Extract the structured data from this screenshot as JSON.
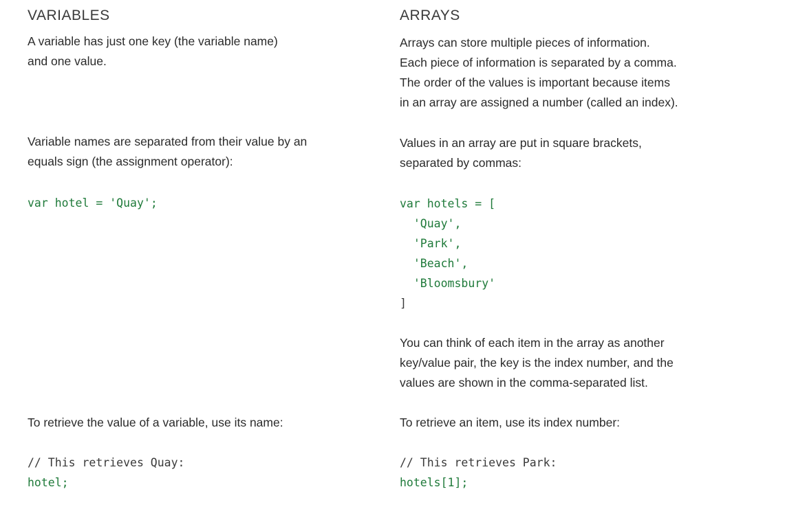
{
  "left": {
    "heading": "VARIABLES",
    "intro": [
      "A variable has just one key (the variable name)",
      "and one value."
    ],
    "assign_text": [
      "Variable names are separated from their value by an",
      "equals sign (the assignment operator):"
    ],
    "code_assign": {
      "kw": "var hotel = ",
      "value": "'Quay'",
      "end": ";"
    },
    "retrieve_text": "To retrieve the value of a variable, use its name:",
    "code_retrieve": {
      "comment": "// This retrieves Quay:",
      "expr": "hotel;"
    }
  },
  "right": {
    "heading": "ARRAYS",
    "intro": [
      "Arrays can store multiple pieces of information.",
      "Each piece of information is separated by a comma.",
      "The order of the values is important because items",
      "in an array are assigned a number (called an index)."
    ],
    "brackets_text": [
      "Values in an array are put in square brackets,",
      "separated by commas:"
    ],
    "code_array": {
      "open": "var hotels = [",
      "items": [
        "  'Quay',",
        "  'Park',",
        "  'Beach',",
        "  'Bloomsbury'"
      ],
      "close": "]"
    },
    "keyvalue_text": [
      "You can think of each item in the array as another",
      "key/value pair, the key is the index number, and the",
      "values are shown in the comma-separated list."
    ],
    "retrieve_text": "To retrieve an item, use its index number:",
    "code_retrieve": {
      "comment": "// This retrieves Park:",
      "expr": "hotels[1];"
    }
  }
}
